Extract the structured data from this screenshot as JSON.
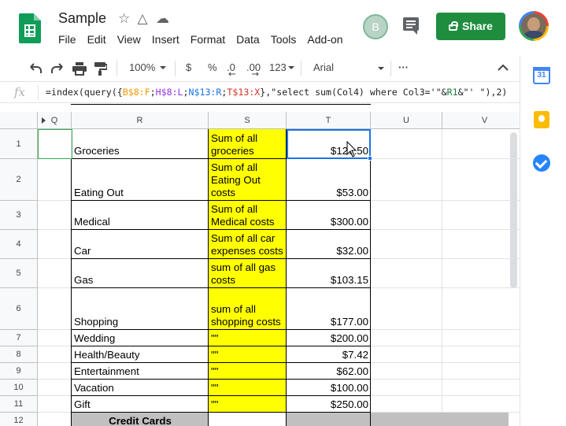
{
  "app": {
    "doc_title": "Sample",
    "menu": [
      "File",
      "Edit",
      "View",
      "Insert",
      "Format",
      "Data",
      "Tools",
      "Add-on"
    ],
    "avatar_initial": "B",
    "share_label": "Share"
  },
  "toolbar": {
    "zoom": "100%",
    "currency": "$",
    "percent": "%",
    "dec_decrease": ".0",
    "dec_increase": ".00",
    "format_more": "123",
    "font": "Arial",
    "more": "···"
  },
  "formula_bar": {
    "fx_label": "fx",
    "formula_parts": [
      {
        "text": "=index(query({",
        "color": ""
      },
      {
        "text": "B$8:F",
        "color": "orange"
      },
      {
        "text": ";",
        "color": ""
      },
      {
        "text": "H$8:L",
        "color": "purple"
      },
      {
        "text": ";",
        "color": ""
      },
      {
        "text": "N$13:R",
        "color": "blue"
      },
      {
        "text": ";",
        "color": ""
      },
      {
        "text": "T$13:X",
        "color": "red"
      },
      {
        "text": "},\"select sum(Col4) where Col3='\"&",
        "color": ""
      },
      {
        "text": "R1",
        "color": "green"
      },
      {
        "text": "&\"' \"),2)",
        "color": ""
      }
    ]
  },
  "sheet": {
    "columns": [
      "Q",
      "R",
      "S",
      "T",
      "U",
      "V"
    ],
    "rows": [
      {
        "num": "1",
        "r": "Groceries",
        "s": "Sum of all groceries",
        "t": "$127.50"
      },
      {
        "num": "2",
        "r": "Eating Out",
        "s": "Sum of all Eating Out costs",
        "t": "$53.00"
      },
      {
        "num": "3",
        "r": "Medical",
        "s": "Sum of all Medical costs",
        "t": "$300.00"
      },
      {
        "num": "4",
        "r": "Car",
        "s": "Sum of all car expenses costs",
        "t": "$32.00"
      },
      {
        "num": "5",
        "r": "Gas",
        "s": "sum of all gas costs",
        "t": "$103.15"
      },
      {
        "num": "6",
        "r": "Shopping",
        "s": "sum of all shopping costs",
        "t": "$177.00"
      },
      {
        "num": "7",
        "r": "Wedding",
        "s": "\"\"",
        "t": "$200.00"
      },
      {
        "num": "8",
        "r": "Health/Beauty",
        "s": "\"\"",
        "t": "$7.42"
      },
      {
        "num": "9",
        "r": "Entertainment",
        "s": "\"\"",
        "t": "$62.00"
      },
      {
        "num": "10",
        "r": "Vacation",
        "s": "\"\"",
        "t": "$100.00"
      },
      {
        "num": "11",
        "r": "Gift",
        "s": "\"\"",
        "t": "$250.00"
      },
      {
        "num": "12",
        "r": "Credit Cards",
        "s": "",
        "t": ""
      }
    ]
  },
  "side_panel": {
    "calendar_day": "31"
  },
  "colors": {
    "accent": "#1a73e8",
    "share_green": "#1e8e3e",
    "highlight_yellow": "#ffff00"
  },
  "icons": [
    "spreadsheet-logo-icon",
    "star-icon",
    "drive-move-icon",
    "cloud-status-icon",
    "comment-icon",
    "lock-icon",
    "undo-icon",
    "redo-icon",
    "print-icon",
    "paint-format-icon",
    "collapse-chevron-icon",
    "calendar-icon",
    "keep-icon",
    "tasks-icon",
    "mouse-cursor-icon"
  ]
}
